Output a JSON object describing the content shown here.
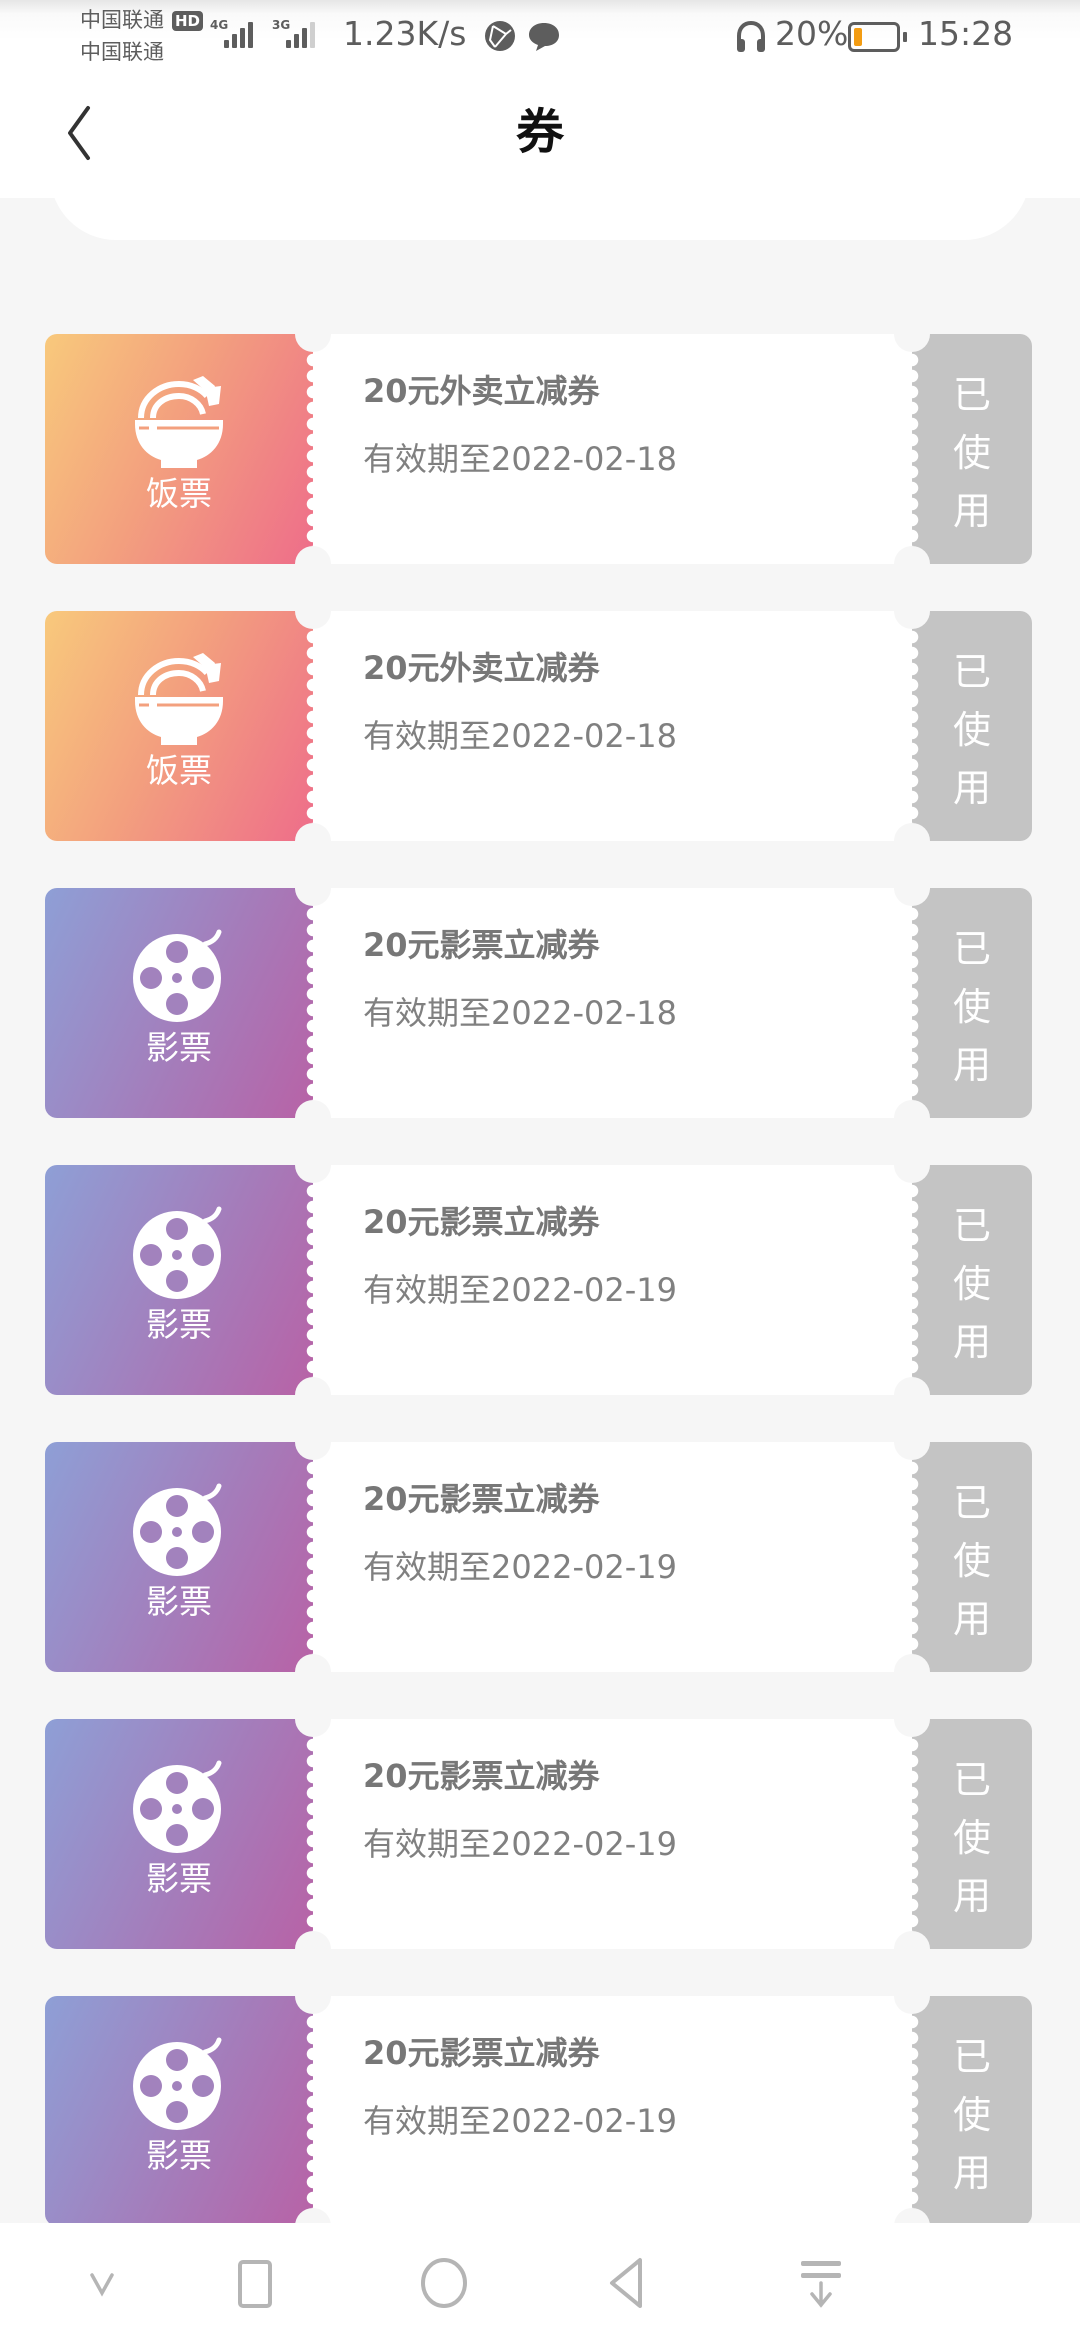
{
  "status_bar": {
    "carrier_1": "中国联通",
    "carrier_2": "中国联通",
    "hd_badge": "HD",
    "signal_1_type": "4G",
    "signal_2_type": "3G",
    "network_speed": "1.23K/s",
    "icons": [
      "network-share-icon",
      "chat-bubble-icon",
      "headphones-icon",
      "battery-icon"
    ],
    "battery_percent": "20%",
    "battery_level": 0.2,
    "time": "15:28",
    "battery_color": "#f39c12"
  },
  "header": {
    "back_icon": "chevron-left-icon",
    "title": "券"
  },
  "coupons": [
    {
      "type": "food",
      "stub_label": "饭票",
      "icon": "rice-bowl-icon",
      "title": "20元外卖立减券",
      "validity": "有效期至2022-02-18",
      "status": [
        "已",
        "使",
        "用"
      ]
    },
    {
      "type": "food",
      "stub_label": "饭票",
      "icon": "rice-bowl-icon",
      "title": "20元外卖立减券",
      "validity": "有效期至2022-02-18",
      "status": [
        "已",
        "使",
        "用"
      ]
    },
    {
      "type": "movie",
      "stub_label": "影票",
      "icon": "film-reel-icon",
      "title": "20元影票立减券",
      "validity": "有效期至2022-02-18",
      "status": [
        "已",
        "使",
        "用"
      ]
    },
    {
      "type": "movie",
      "stub_label": "影票",
      "icon": "film-reel-icon",
      "title": "20元影票立减券",
      "validity": "有效期至2022-02-19",
      "status": [
        "已",
        "使",
        "用"
      ]
    },
    {
      "type": "movie",
      "stub_label": "影票",
      "icon": "film-reel-icon",
      "title": "20元影票立减券",
      "validity": "有效期至2022-02-19",
      "status": [
        "已",
        "使",
        "用"
      ]
    },
    {
      "type": "movie",
      "stub_label": "影票",
      "icon": "film-reel-icon",
      "title": "20元影票立减券",
      "validity": "有效期至2022-02-19",
      "status": [
        "已",
        "使",
        "用"
      ]
    },
    {
      "type": "movie",
      "stub_label": "影票",
      "icon": "film-reel-icon",
      "title": "20元影票立减券",
      "validity": "有效期至2022-02-19",
      "status": [
        "已",
        "使",
        "用"
      ]
    }
  ],
  "colors": {
    "food_gradient": [
      "#f8c97c",
      "#ee6d8a"
    ],
    "movie_gradient": [
      "#8e9fd6",
      "#b862a6"
    ],
    "used_stub": "#c4c4c4",
    "text_gray": "#777777",
    "page_background": "#f6f6f6"
  },
  "nav_bar": {
    "buttons": [
      "hide-nav-chevron-icon",
      "recents-square-icon",
      "home-circle-icon",
      "back-triangle-icon",
      "notification-pull-down-icon"
    ]
  }
}
